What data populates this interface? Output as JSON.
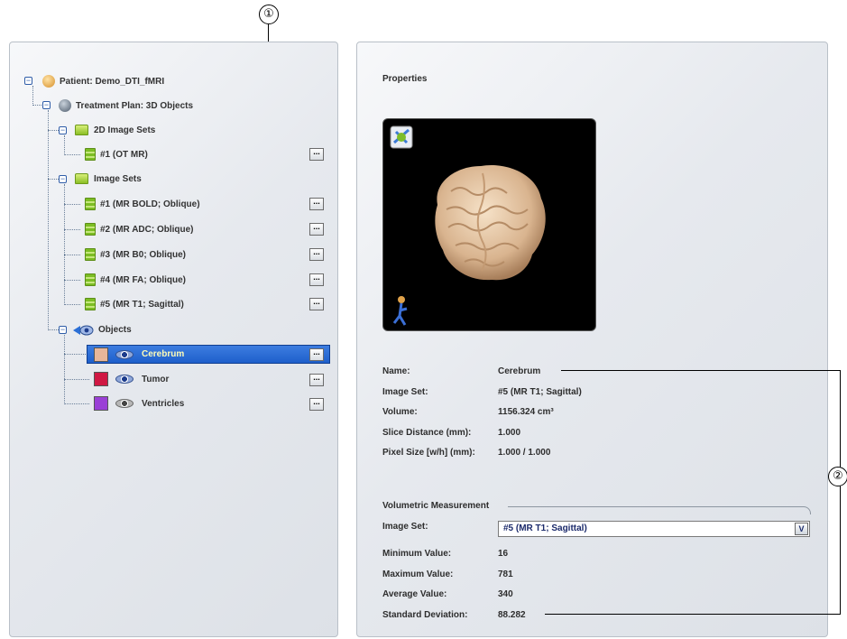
{
  "callouts": {
    "one": "①",
    "two": "②"
  },
  "tree": {
    "patient": "Patient: Demo_DTI_fMRI",
    "plan": "Treatment Plan: 3D Objects",
    "image_sets_2d": "2D Image Sets",
    "image_sets_2d_items": [
      "#1 (OT MR)"
    ],
    "image_sets": "Image Sets",
    "image_sets_items": [
      "#1 (MR BOLD; Oblique)",
      "#2 (MR ADC; Oblique)",
      "#3 (MR B0; Oblique)",
      "#4 (MR FA; Oblique)",
      "#5 (MR T1; Sagittal)"
    ],
    "objects": "Objects",
    "objects_items": [
      {
        "label": "Cerebrum",
        "color": "#e7b69a"
      },
      {
        "label": "Tumor",
        "color": "#d01843"
      },
      {
        "label": "Ventricles",
        "color": "#9a3fd6"
      }
    ],
    "dots_label": "..."
  },
  "properties": {
    "title": "Properties",
    "fields": [
      {
        "label": "Name:",
        "value": "Cerebrum"
      },
      {
        "label": "Image Set:",
        "value": "#5 (MR T1; Sagittal)"
      },
      {
        "label": "Volume:",
        "value": "1156.324  cm³"
      },
      {
        "label": "Slice Distance (mm):",
        "value": "1.000"
      },
      {
        "label": "Pixel Size [w/h] (mm):",
        "value": "1.000 / 1.000"
      }
    ]
  },
  "volumetric": {
    "title": "Volumetric Measurement",
    "image_set_label": "Image Set:",
    "image_set_value": "#5 (MR T1; Sagittal)",
    "dropdown_arrow": "V",
    "fields": [
      {
        "label": "Minimum Value:",
        "value": "16"
      },
      {
        "label": "Maximum Value:",
        "value": "781"
      },
      {
        "label": "Average Value:",
        "value": "340"
      },
      {
        "label": "Standard Deviation:",
        "value": "88.282"
      }
    ]
  }
}
